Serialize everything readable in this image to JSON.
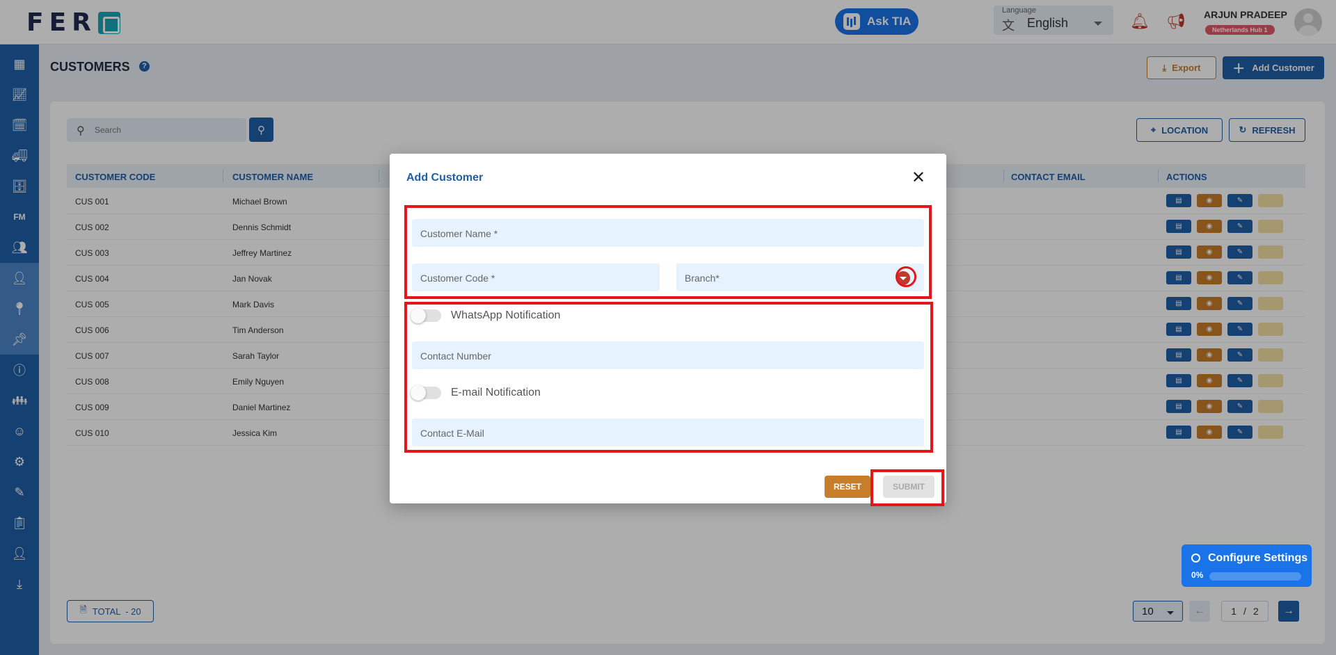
{
  "header": {
    "logo_text": "FER",
    "ask_tia": "Ask TIA",
    "language_caption": "Language",
    "language_value": "English",
    "user_name": "ARJUN PRADEEP",
    "user_hub": "Netherlands Hub 1"
  },
  "page": {
    "title": "CUSTOMERS",
    "export_label": "Export",
    "add_label": "Add Customer"
  },
  "toolbar": {
    "search_placeholder": "Search",
    "location_label": "LOCATION",
    "refresh_label": "REFRESH"
  },
  "table": {
    "columns": [
      "CUSTOMER CODE",
      "CUSTOMER NAME",
      "CONTACT EMAIL",
      "ACTIONS"
    ],
    "rows": [
      {
        "code": "CUS 001",
        "name": "Michael Brown"
      },
      {
        "code": "CUS 002",
        "name": "Dennis Schmidt"
      },
      {
        "code": "CUS 003",
        "name": "Jeffrey Martinez"
      },
      {
        "code": "CUS 004",
        "name": "Jan Novak"
      },
      {
        "code": "CUS 005",
        "name": "Mark Davis"
      },
      {
        "code": "CUS 006",
        "name": "Tim Anderson"
      },
      {
        "code": "CUS 007",
        "name": "Sarah Taylor"
      },
      {
        "code": "CUS 008",
        "name": "Emily Nguyen"
      },
      {
        "code": "CUS 009",
        "name": "Daniel Martinez"
      },
      {
        "code": "CUS 010",
        "name": "Jessica Kim"
      }
    ]
  },
  "footer": {
    "total_label": "TOTAL  - 20",
    "page_size": "10",
    "current_page": "1",
    "page_sep": "/",
    "total_pages": "2"
  },
  "configure": {
    "title": "Configure Settings",
    "percent_label": "0%",
    "progress": 0
  },
  "modal": {
    "title": "Add Customer",
    "customer_name": "Customer Name *",
    "customer_code": "Customer Code *",
    "branch": "Branch*",
    "whatsapp_label": "WhatsApp Notification",
    "contact_number": "Contact Number",
    "email_label": "E-mail Notification",
    "contact_email": "Contact E-Mail",
    "reset_label": "RESET",
    "submit_label": "SUBMIT"
  },
  "colors": {
    "primary": "#1f5fa8",
    "accent": "#c87d2a",
    "highlight": "#e3161c"
  }
}
